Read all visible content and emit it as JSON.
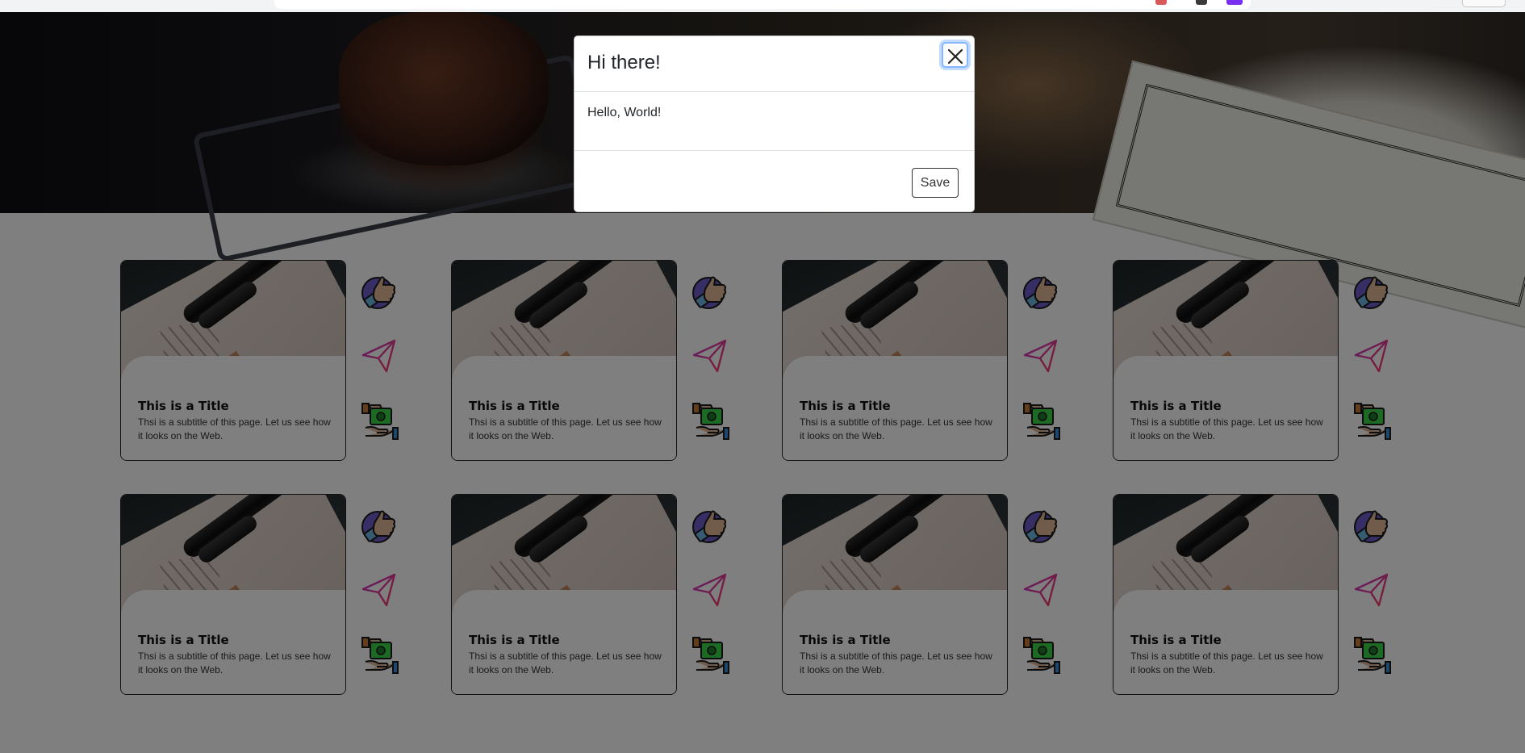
{
  "modal": {
    "title": "Hi there!",
    "body": "Hello, World!",
    "save_label": "Save",
    "close_icon": "close-x-icon"
  },
  "icons": {
    "like": "thumbs-up-icon",
    "send": "paper-plane-icon",
    "pay": "money-in-hand-icon"
  },
  "cards": [
    {
      "title": "This is a Title",
      "subtitle": "Thsi is a subtitle of this page. Let us see how it looks on the Web."
    },
    {
      "title": "This is a Title",
      "subtitle": "Thsi is a subtitle of this page. Let us see how it looks on the Web."
    },
    {
      "title": "This is a Title",
      "subtitle": "Thsi is a subtitle of this page. Let us see how it looks on the Web."
    },
    {
      "title": "This is a Title",
      "subtitle": "Thsi is a subtitle of this page. Let us see how it looks on the Web."
    },
    {
      "title": "This is a Title",
      "subtitle": "Thsi is a subtitle of this page. Let us see how it looks on the Web."
    },
    {
      "title": "This is a Title",
      "subtitle": "Thsi is a subtitle of this page. Let us see how it looks on the Web."
    },
    {
      "title": "This is a Title",
      "subtitle": "Thsi is a subtitle of this page. Let us see how it looks on the Web."
    },
    {
      "title": "This is a Title",
      "subtitle": "Thsi is a subtitle of this page. Let us see how it looks on the Web."
    }
  ],
  "colors": {
    "overlay": "#000000",
    "focus_ring": "#86b7fe",
    "like_icon_skin": "#e3b896",
    "like_icon_circle": "#6c5cc8",
    "like_icon_cuff": "#6fb6e0",
    "send_icon_gradient_start": "#c23bd4",
    "send_icon_gradient_end": "#ff3b5c",
    "money_green": "#3bd44a"
  }
}
